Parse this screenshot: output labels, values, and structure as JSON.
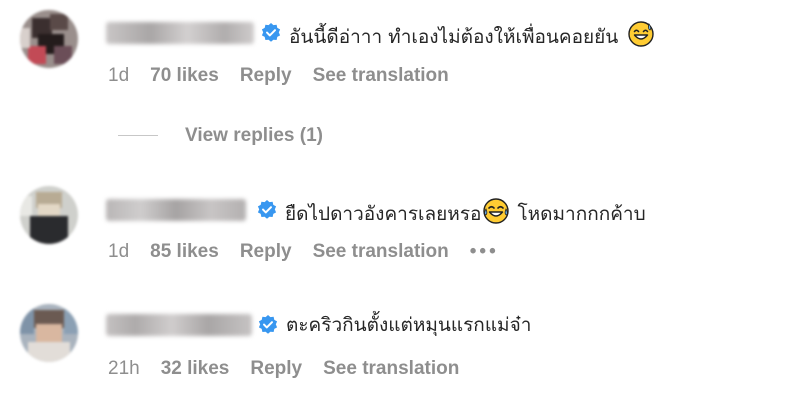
{
  "comments": [
    {
      "text": "อันนี้ดีอ่าาา ทำเองไม่ต้องให้เพื่อนคอยยัน",
      "emoji_icon": "sweat-smile-emoji",
      "time": "1d",
      "likes": "70 likes",
      "reply_label": "Reply",
      "translation_label": "See translation"
    },
    {
      "text_before_emoji": "ยืดไปดาวอังคารเลยหรอ",
      "emoji_icon": "tears-of-joy-emoji",
      "text_after_emoji": "โหดมากกกค้าบ",
      "time": "1d",
      "likes": "85 likes",
      "reply_label": "Reply",
      "translation_label": "See translation",
      "more_label": "•••"
    },
    {
      "text": "ตะคริวกินตั้งแต่หมุนแรกแม่จ๋า",
      "time": "21h",
      "likes": "32 likes",
      "reply_label": "Reply",
      "translation_label": "See translation"
    }
  ],
  "view_replies_label": "View replies (1)",
  "colors": {
    "text": "#262626",
    "meta": "#8e8e8e",
    "verified": "#3897f0"
  }
}
